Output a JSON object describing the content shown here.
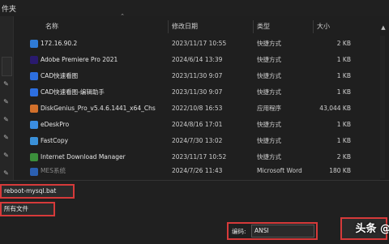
{
  "window": {
    "title": "件夹"
  },
  "columns": {
    "name": "名称",
    "date": "修改日期",
    "type": "类型",
    "size": "大小"
  },
  "files": [
    {
      "name": "172.16.90.2",
      "date": "2023/11/17 10:55",
      "type": "快捷方式",
      "size": "2 KB",
      "icon": "shortcut-icon",
      "color": "#2f7bd6"
    },
    {
      "name": "Adobe Premiere Pro 2021",
      "date": "2024/6/14 13:39",
      "type": "快捷方式",
      "size": "1 KB",
      "icon": "premiere-icon",
      "color": "#2a1a6e"
    },
    {
      "name": "CAD快速看图",
      "date": "2023/11/30 9:07",
      "type": "快捷方式",
      "size": "1 KB",
      "icon": "cad-viewer-icon",
      "color": "#2d6fe0"
    },
    {
      "name": "CAD快速看图-编辑助手",
      "date": "2023/11/30 9:07",
      "type": "快捷方式",
      "size": "1 KB",
      "icon": "cad-editor-icon",
      "color": "#2d6fe0"
    },
    {
      "name": "DiskGenius_Pro_v5.4.6.1441_x64_Chs",
      "date": "2022/10/8 16:53",
      "type": "应用程序",
      "size": "43,044 KB",
      "icon": "diskgenius-icon",
      "color": "#d2702b"
    },
    {
      "name": "eDeskPro",
      "date": "2024/8/16 17:01",
      "type": "快捷方式",
      "size": "1 KB",
      "icon": "edesk-icon",
      "color": "#3a8de0"
    },
    {
      "name": "FastCopy",
      "date": "2024/7/30 13:02",
      "type": "快捷方式",
      "size": "1 KB",
      "icon": "fastcopy-icon",
      "color": "#3a90d8"
    },
    {
      "name": "Internet Download Manager",
      "date": "2023/11/17 10:52",
      "type": "快捷方式",
      "size": "2 KB",
      "icon": "idm-icon",
      "color": "#3b8f3b"
    },
    {
      "name": "MES系统",
      "date": "2024/7/26 11:43",
      "type": "Microsoft Word",
      "size": "180 KB",
      "icon": "word-icon",
      "color": "#2b5fb0"
    }
  ],
  "footer": {
    "filename_value": "reboot-mysql.bat",
    "filetype_value": "所有文件",
    "encoding_label": "编码:",
    "encoding_value": "ANSI",
    "watermark": "头条 @"
  }
}
